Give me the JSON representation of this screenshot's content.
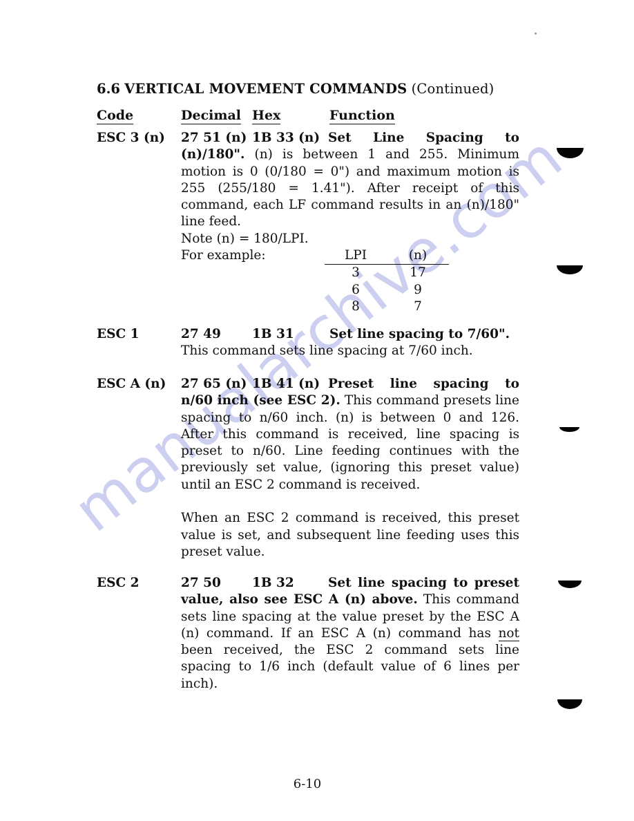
{
  "page": {
    "section_number": "6.6",
    "section_title": "VERTICAL MOVEMENT COMMANDS",
    "section_continued": "(Continued)",
    "page_number": "6-10",
    "watermark_text": "manualarchive.com",
    "watermark_color": "#b9bdea",
    "paper_color": "#ffffff",
    "ink_color": "#121211"
  },
  "columns": {
    "code": "Code",
    "decimal": "Decimal",
    "hex": "Hex",
    "function": "Function"
  },
  "commands": [
    {
      "code": "ESC 3 (n)",
      "decimal": "27 51 (n)",
      "hex": "1B 33 (n)",
      "function_bold": "Set Line Spacing to (n)/180\".",
      "function_rest": "(n) is between 1 and 255. Minimum motion is 0 (0/180 = 0\") and maximum motion is 255 (255/180 = 1.41\"). After receipt of this command, each LF command results in an (n)/180\" line feed.",
      "note": "Note (n) = 180/LPI.",
      "example_label": "For example:"
    },
    {
      "code": "ESC 1",
      "decimal": "27 49",
      "hex": "1B 31",
      "function_bold": "Set line spacing to 7/60\".",
      "function_rest": "This command sets line spacing at 7/60 inch."
    },
    {
      "code": "ESC A (n)",
      "decimal": "27 65 (n)",
      "hex": "1B 41 (n)",
      "function_bold": "Preset line spacing to n/60 inch (see ESC 2).",
      "function_rest": "This command presets line spacing to n/60 inch. (n) is between 0 and 126. After this command is received, line spacing is preset to n/60. Line feeding continues with the previously set value, (ignoring this preset value) until an ESC 2 command is received.",
      "paragraph_2": "When an ESC 2 command is received, this preset value is set, and subsequent line feeding uses this preset value."
    },
    {
      "code": "ESC 2",
      "decimal": "27 50",
      "hex": "1B 32",
      "function_bold": "Set line spacing to preset value, also see ESC A (n) above.",
      "function_rest_a": "This command sets line spacing at the value preset by the ESC A (n) command. If an ESC A (n) command has ",
      "function_underlined": "not",
      "function_rest_b": " been received, the ESC 2 command sets line spacing to 1/6 inch (default value of 6 lines per inch)."
    }
  ],
  "example_table": {
    "headers": [
      "LPI",
      "(n)"
    ],
    "rows": [
      [
        "3",
        "17"
      ],
      [
        "6",
        "9"
      ],
      [
        "8",
        "7"
      ]
    ]
  }
}
